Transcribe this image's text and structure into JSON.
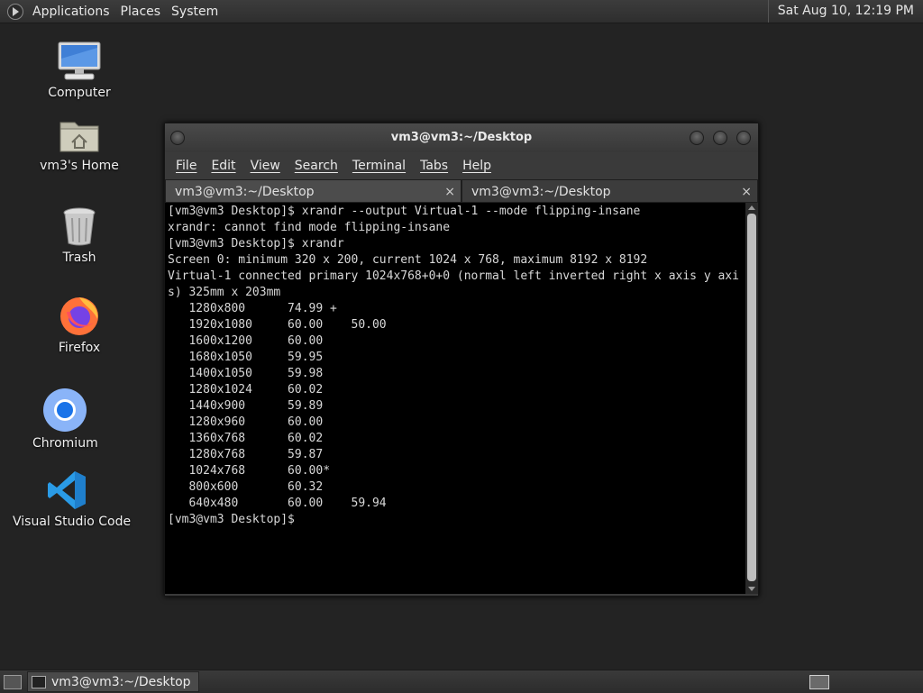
{
  "top_panel": {
    "menus": [
      "Applications",
      "Places",
      "System"
    ],
    "clock": "Sat Aug 10, 12:19 PM"
  },
  "desktop": {
    "icons": [
      {
        "label": "Computer",
        "icon": "computer-icon"
      },
      {
        "label": "vm3's Home",
        "icon": "home-folder-icon"
      },
      {
        "label": "Trash",
        "icon": "trash-icon"
      },
      {
        "label": "Firefox",
        "icon": "firefox-icon"
      },
      {
        "label": "Chromium",
        "icon": "chromium-icon"
      },
      {
        "label": "Visual Studio Code",
        "icon": "vscode-icon"
      }
    ]
  },
  "terminal": {
    "title": "vm3@vm3:~/Desktop",
    "menu": [
      "File",
      "Edit",
      "View",
      "Search",
      "Terminal",
      "Tabs",
      "Help"
    ],
    "tabs": [
      {
        "label": "vm3@vm3:~/Desktop",
        "active": true
      },
      {
        "label": "vm3@vm3:~/Desktop",
        "active": false
      }
    ],
    "close_glyph": "×",
    "lines": [
      "[vm3@vm3 Desktop]$ xrandr --output Virtual-1 --mode flipping-insane",
      "xrandr: cannot find mode flipping-insane",
      "[vm3@vm3 Desktop]$ xrandr",
      "Screen 0: minimum 320 x 200, current 1024 x 768, maximum 8192 x 8192",
      "Virtual-1 connected primary 1024x768+0+0 (normal left inverted right x axis y axis) 325mm x 203mm",
      "   1280x800      74.99 +",
      "   1920x1080     60.00    50.00",
      "   1600x1200     60.00",
      "   1680x1050     59.95",
      "   1400x1050     59.98",
      "   1280x1024     60.02",
      "   1440x900      59.89",
      "   1280x960      60.00",
      "   1360x768      60.02",
      "   1280x768      59.87",
      "   1024x768      60.00*",
      "   800x600       60.32",
      "   640x480       60.00    59.94",
      "[vm3@vm3 Desktop]$ "
    ]
  },
  "bottom_panel": {
    "task_label": "vm3@vm3:~/Desktop"
  }
}
